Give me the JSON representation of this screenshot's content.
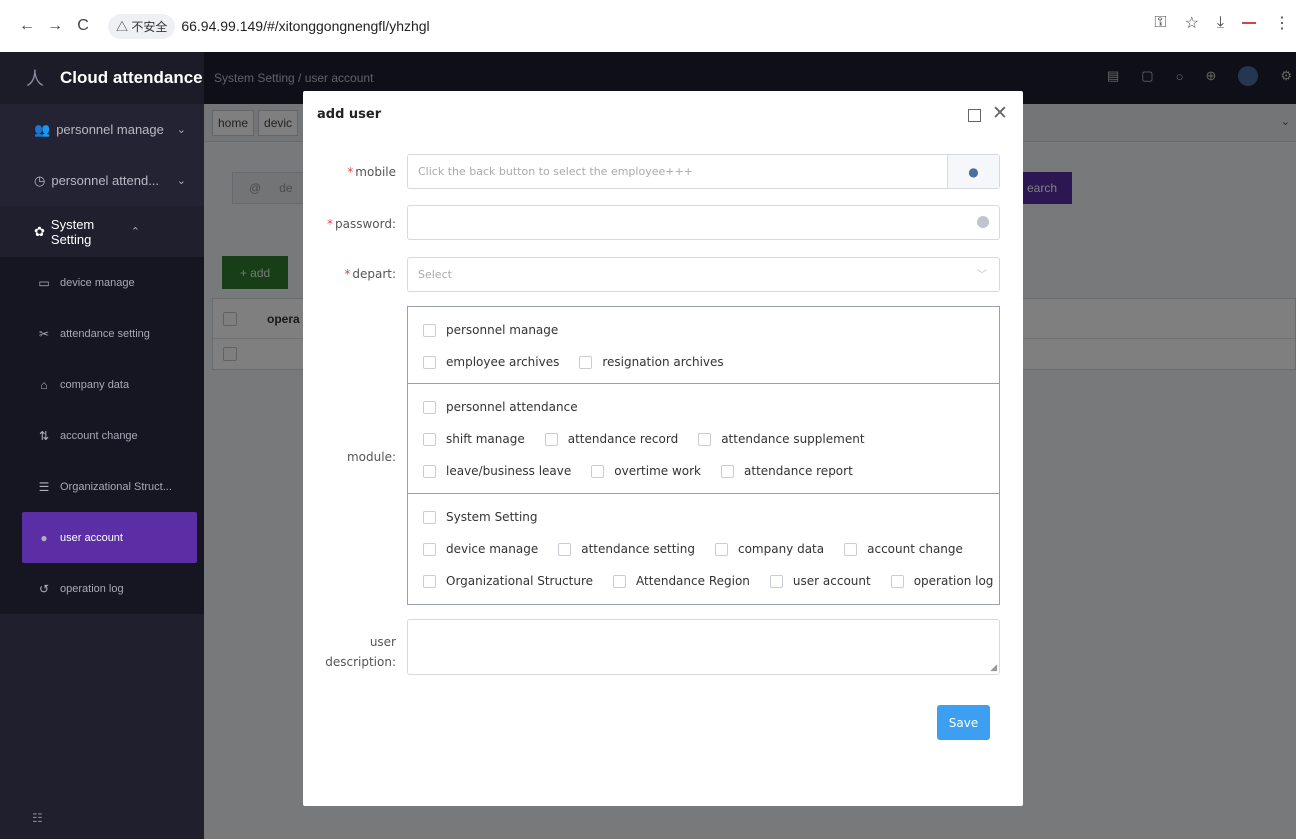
{
  "browser": {
    "back": "←",
    "forward": "→",
    "reload": "C",
    "insecure_label": "△ 不安全",
    "url": "66.94.99.149/#/xitonggongnengfl/yhzhgl"
  },
  "app": {
    "title": "Cloud attendance",
    "breadcrumb": "System Setting  /  user account",
    "menu": {
      "personnel_manage": "personnel manage",
      "personnel_attend": "personnel attend...",
      "system_setting": "System Setting"
    },
    "submenu": [
      {
        "label": "device manage",
        "icon": "monitor-icon"
      },
      {
        "label": "attendance setting",
        "icon": "tools-icon"
      },
      {
        "label": "company data",
        "icon": "bank-icon"
      },
      {
        "label": "account change",
        "icon": "swap-icon"
      },
      {
        "label": "Organizational Struct...",
        "icon": "tree-icon"
      },
      {
        "label": "user account",
        "icon": "user-icon"
      },
      {
        "label": "operation log",
        "icon": "history-icon"
      }
    ],
    "tabs": [
      "home",
      "devic"
    ],
    "search_prefix": "@",
    "search_placeholder": "de",
    "search_button": "earch",
    "add_button": "+ add",
    "table_header_operation": "opera"
  },
  "dialog": {
    "title": "add user",
    "mobile_label": "mobile",
    "mobile_placeholder": "Click the back button to select the employee+++",
    "password_label": "password:",
    "depart_label": "depart:",
    "depart_placeholder": "Select",
    "module_label": "module:",
    "description_label_line1": "user",
    "description_label_line2": "description:",
    "save_button": "Save",
    "modules": {
      "personnel_manage": "personnel manage",
      "employee_archives": "employee archives",
      "resignation_archives": "resignation archives",
      "personnel_attendance": "personnel attendance",
      "shift_manage": "shift manage",
      "attendance_record": "attendance record",
      "attendance_supplement": "attendance supplement",
      "leave_business_leave": "leave/business leave",
      "overtime_work": "overtime work",
      "attendance_report": "attendance report",
      "system_setting": "System Setting",
      "device_manage": "device manage",
      "attendance_setting": "attendance setting",
      "company_data": "company data",
      "account_change": "account change",
      "organizational_structure": "Organizational Structure",
      "attendance_region": "Attendance Region",
      "user_account": "user account",
      "operation_log": "operation log"
    }
  },
  "colors": {
    "sidebar": "#1f1f2e",
    "accent_purple": "#5b2ea6",
    "add_green": "#2f7d2f",
    "save_blue": "#3d9ff2",
    "required_red": "#e64242"
  }
}
